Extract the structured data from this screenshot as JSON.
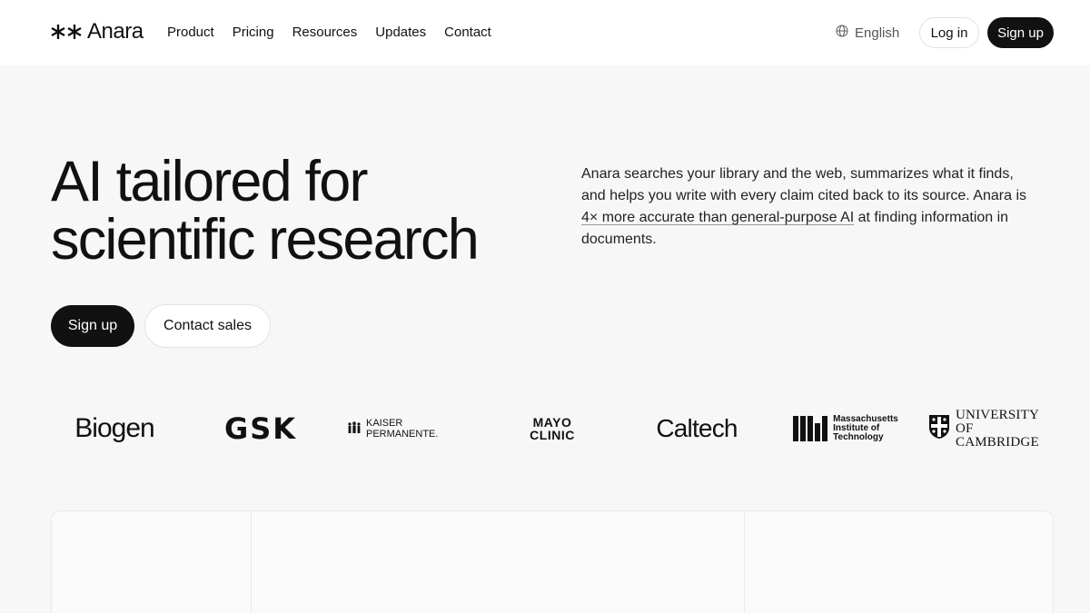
{
  "header": {
    "brand": "Anara",
    "nav": [
      "Product",
      "Pricing",
      "Resources",
      "Updates",
      "Contact"
    ],
    "language": "English",
    "login_label": "Log in",
    "signup_label": "Sign up"
  },
  "hero": {
    "title_line1": "AI tailored for",
    "title_line2": "scientific research",
    "desc_before": "Anara searches your library and the web, summarizes what it finds, and helps you write with every claim cited back to its source. Anara is ",
    "desc_link": "4× more accurate than general-purpose AI",
    "desc_after": " at finding information in documents.",
    "signup_label": "Sign up",
    "contact_label": "Contact sales"
  },
  "clients": {
    "biogen": "Biogen",
    "gsk": "GSK",
    "kaiser": "KAISER PERMANENTE.",
    "mayo_line1": "MAYO",
    "mayo_line2": "CLINIC",
    "caltech": "Caltech",
    "mit_line1": "Massachusetts",
    "mit_line2": "Institute of",
    "mit_line3": "Technology",
    "cambridge_line1": "UNIVERSITY OF",
    "cambridge_line2": "CAMBRIDGE"
  },
  "colors": {
    "primary": "#111111",
    "background": "#f7f7f7",
    "header_bg": "#ffffff",
    "muted_text": "#555555"
  },
  "icons": {
    "logo_mark": "double-asterisk-icon",
    "language": "globe-icon",
    "kaiser": "kaiser-people-icon",
    "mit": "mit-bars-icon",
    "cambridge": "cambridge-shield-icon"
  }
}
